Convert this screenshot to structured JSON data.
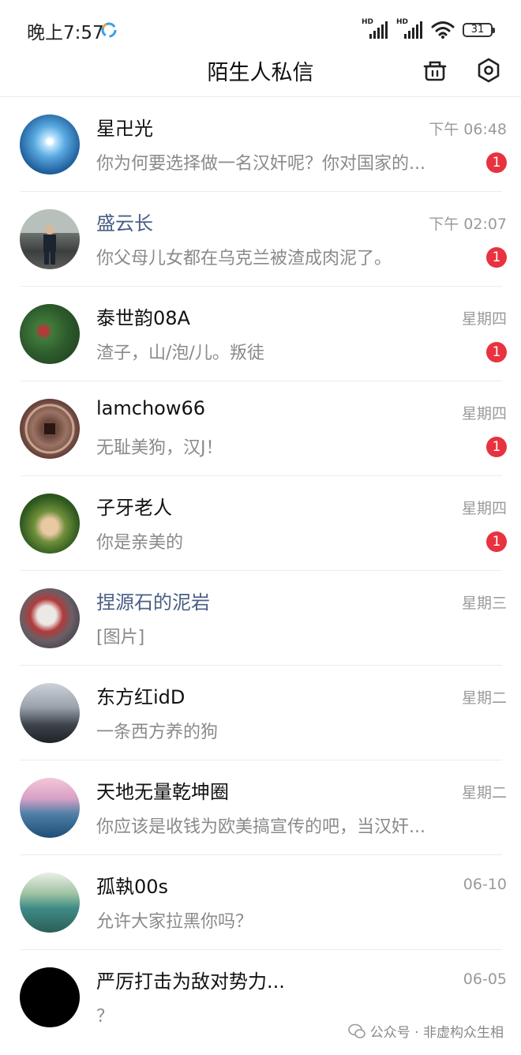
{
  "status_bar": {
    "time": "晚上7:57",
    "battery": "31",
    "sim1_label": "HD",
    "sim2_label": "HD"
  },
  "header": {
    "title": "陌生人私信",
    "left_icon": "clear-unread-icon",
    "right_icon": "settings-icon"
  },
  "conversations": [
    {
      "name": "星卍光",
      "time": "下午 06:48",
      "preview": "你为何要选择做一名汉奸呢？你对国家的...",
      "unread": "1",
      "name_color": "#111111"
    },
    {
      "name": "盛云长",
      "time": "下午 02:07",
      "preview": "你父母儿女都在乌克兰被渣成肉泥了。",
      "unread": "1",
      "name_color": "#4a5f85"
    },
    {
      "name": "泰世韵08A",
      "time": "星期四",
      "preview": "渣子，山/泡/儿。叛徒",
      "unread": "1",
      "name_color": "#111111"
    },
    {
      "name": "lamchow66",
      "time": "星期四",
      "preview": "无耻美狗，汉J！",
      "unread": "1",
      "name_color": "#111111"
    },
    {
      "name": "子牙老人",
      "time": "星期四",
      "preview": "你是亲美的",
      "unread": "1",
      "name_color": "#111111"
    },
    {
      "name": "捏源石的泥岩",
      "time": "星期三",
      "preview": "[图片]",
      "unread": "",
      "name_color": "#4a5f85"
    },
    {
      "name": "东方红idD",
      "time": "星期二",
      "preview": "一条西方养的狗",
      "unread": "",
      "name_color": "#111111"
    },
    {
      "name": "天地无量乾坤圈",
      "time": "星期二",
      "preview": "你应该是收钱为欧美搞宣传的吧，当汉奸...",
      "unread": "",
      "name_color": "#111111"
    },
    {
      "name": "孤執00s",
      "time": "06-10",
      "preview": "允许大家拉黑你吗？",
      "unread": "",
      "name_color": "#111111"
    },
    {
      "name": "严厉打击为敌对势力...",
      "time": "06-05",
      "preview": "？",
      "unread": "",
      "name_color": "#111111"
    }
  ],
  "watermark": {
    "text": "公众号 · 非虚构众生相"
  },
  "colors": {
    "badge": "#e8323f",
    "secondary_text": "#8a8a8a",
    "highlight_name": "#4a5f85"
  }
}
